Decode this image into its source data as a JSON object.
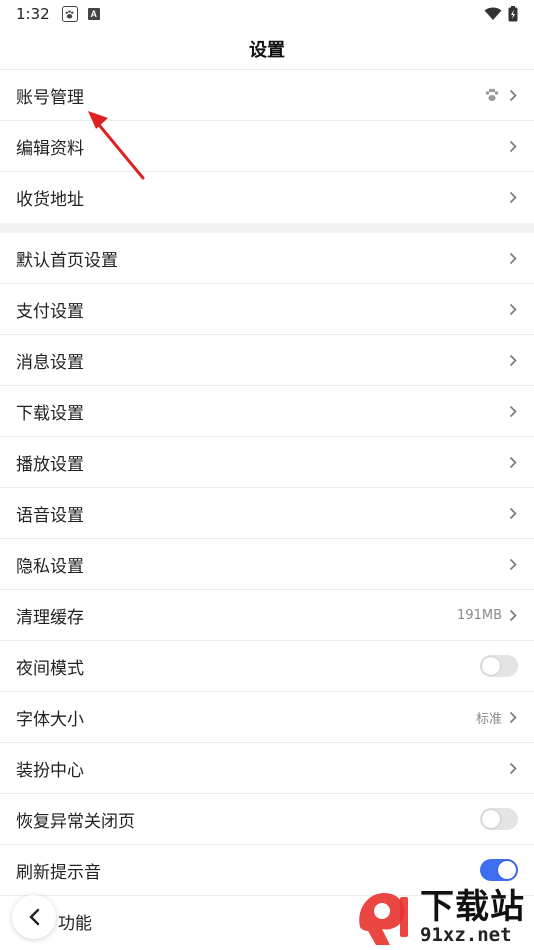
{
  "status_bar": {
    "time": "1:32",
    "a_icon": "A"
  },
  "header": {
    "title": "设置"
  },
  "group1": [
    {
      "label": "账号管理",
      "icon": "paw-icon"
    },
    {
      "label": "编辑资料"
    },
    {
      "label": "收货地址"
    }
  ],
  "group2": [
    {
      "label": "默认首页设置"
    },
    {
      "label": "支付设置"
    },
    {
      "label": "消息设置"
    },
    {
      "label": "下载设置"
    },
    {
      "label": "播放设置"
    },
    {
      "label": "语音设置"
    },
    {
      "label": "隐私设置"
    },
    {
      "label": "清理缓存",
      "value": "191MB"
    },
    {
      "label": "夜间模式",
      "toggle": false
    },
    {
      "label": "字体大小",
      "value": "标准"
    },
    {
      "label": "装扮中心"
    },
    {
      "label": "恢复异常关闭页",
      "toggle": false
    },
    {
      "label": "刷新提示音",
      "toggle": true
    },
    {
      "label": "功能"
    }
  ],
  "watermark": {
    "title": "下载站",
    "url": "91xz.net"
  },
  "colors": {
    "accent": "#3d6ef0",
    "annotation": "#e02020",
    "watermark_red": "#e8322d"
  }
}
